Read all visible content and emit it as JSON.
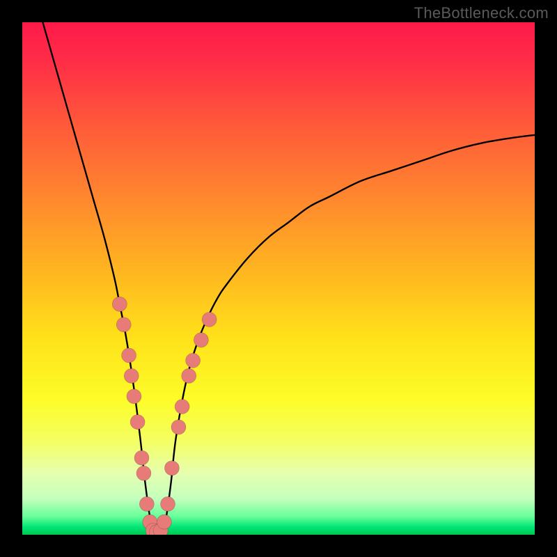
{
  "watermark": {
    "text": "TheBottleneck.com"
  },
  "colors": {
    "frame_bg": "#000000",
    "curve": "#000000",
    "dot_fill": "#e77b77",
    "dot_stroke": "rgba(0,0,0,0.25)"
  },
  "gradient_stops": [
    {
      "offset": 0.0,
      "color": "#ff1a4a"
    },
    {
      "offset": 0.08,
      "color": "#ff2f47"
    },
    {
      "offset": 0.2,
      "color": "#ff5a3a"
    },
    {
      "offset": 0.35,
      "color": "#ff8a2e"
    },
    {
      "offset": 0.5,
      "color": "#ffbb1f"
    },
    {
      "offset": 0.62,
      "color": "#ffe31a"
    },
    {
      "offset": 0.74,
      "color": "#fdfd2a"
    },
    {
      "offset": 0.82,
      "color": "#f4ff66"
    },
    {
      "offset": 0.88,
      "color": "#e6ffb0"
    },
    {
      "offset": 0.93,
      "color": "#c4ffbd"
    },
    {
      "offset": 0.965,
      "color": "#66ff99"
    },
    {
      "offset": 0.985,
      "color": "#00e676"
    },
    {
      "offset": 1.0,
      "color": "#00c853"
    }
  ],
  "chart_data": {
    "type": "line",
    "title": "",
    "xlabel": "",
    "ylabel": "",
    "xlim": [
      0,
      100
    ],
    "ylim": [
      0,
      100
    ],
    "series": [
      {
        "name": "bottleneck-curve",
        "x": [
          4,
          6,
          8,
          10,
          12,
          14,
          16,
          18,
          19,
          20,
          21,
          22,
          23,
          24,
          25,
          26,
          27,
          28,
          29,
          30,
          32,
          34,
          36,
          38,
          40,
          44,
          48,
          52,
          56,
          60,
          66,
          72,
          78,
          84,
          90,
          96,
          100
        ],
        "y": [
          100,
          93,
          86,
          79,
          72,
          65,
          58,
          50,
          45,
          40,
          34,
          27,
          19,
          10,
          3,
          0,
          0,
          3,
          10,
          19,
          30,
          37,
          42,
          46,
          49,
          54,
          58,
          61,
          64,
          66,
          69,
          71,
          73,
          75,
          76.5,
          77.5,
          78
        ]
      }
    ],
    "dots": [
      {
        "x": 19.0,
        "y": 45
      },
      {
        "x": 19.8,
        "y": 41
      },
      {
        "x": 20.8,
        "y": 35
      },
      {
        "x": 21.3,
        "y": 31
      },
      {
        "x": 21.8,
        "y": 27
      },
      {
        "x": 22.5,
        "y": 22
      },
      {
        "x": 23.3,
        "y": 15
      },
      {
        "x": 23.7,
        "y": 12
      },
      {
        "x": 24.3,
        "y": 6
      },
      {
        "x": 24.9,
        "y": 2.5
      },
      {
        "x": 25.5,
        "y": 0.8
      },
      {
        "x": 26.2,
        "y": 0.5
      },
      {
        "x": 27.0,
        "y": 0.8
      },
      {
        "x": 27.7,
        "y": 2.5
      },
      {
        "x": 28.4,
        "y": 6
      },
      {
        "x": 29.2,
        "y": 13
      },
      {
        "x": 30.5,
        "y": 21
      },
      {
        "x": 31.2,
        "y": 25
      },
      {
        "x": 32.5,
        "y": 31
      },
      {
        "x": 33.3,
        "y": 34
      },
      {
        "x": 34.9,
        "y": 38
      },
      {
        "x": 36.5,
        "y": 42
      }
    ]
  }
}
